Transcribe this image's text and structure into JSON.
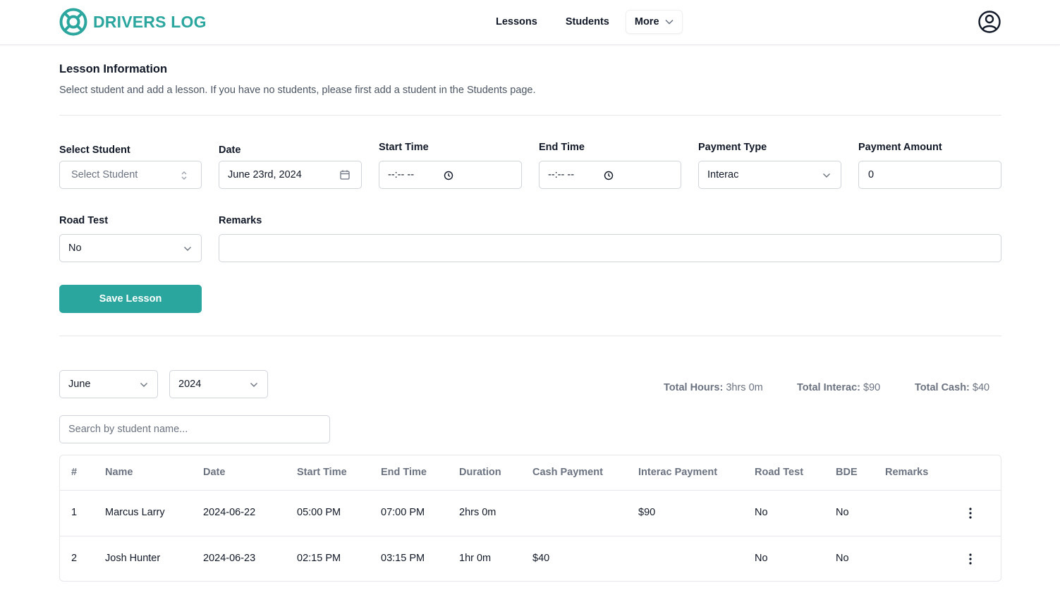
{
  "header": {
    "brand": "DRIVERS LOG",
    "nav": {
      "lessons": "Lessons",
      "students": "Students",
      "more": "More"
    }
  },
  "section": {
    "title": "Lesson Information",
    "description": "Select student and add a lesson. If you have no students, please first add a student in the Students page."
  },
  "form": {
    "student": {
      "label": "Select Student",
      "placeholder": "Select Student"
    },
    "date": {
      "label": "Date",
      "value": "June 23rd, 2024"
    },
    "start_time": {
      "label": "Start Time",
      "value": "--:-- --"
    },
    "end_time": {
      "label": "End Time",
      "value": "--:-- --"
    },
    "payment_type": {
      "label": "Payment Type",
      "value": "Interac"
    },
    "payment_amount": {
      "label": "Payment Amount",
      "value": "0"
    },
    "road_test": {
      "label": "Road Test",
      "value": "No"
    },
    "remarks": {
      "label": "Remarks",
      "value": ""
    },
    "save_label": "Save Lesson"
  },
  "filters": {
    "month": "June",
    "year": "2024",
    "search_placeholder": "Search by student name..."
  },
  "totals": {
    "hours_label": "Total Hours:",
    "hours_value": "3hrs 0m",
    "interac_label": "Total Interac:",
    "interac_value": "$90",
    "cash_label": "Total Cash:",
    "cash_value": "$40"
  },
  "table": {
    "columns": [
      "#",
      "Name",
      "Date",
      "Start Time",
      "End Time",
      "Duration",
      "Cash Payment",
      "Interac Payment",
      "Road Test",
      "BDE",
      "Remarks"
    ],
    "rows": [
      {
        "num": "1",
        "name": "Marcus Larry",
        "date": "2024-06-22",
        "start": "05:00 PM",
        "end": "07:00 PM",
        "duration": "2hrs 0m",
        "cash": "",
        "interac": "$90",
        "road_test": "No",
        "bde": "No",
        "remarks": ""
      },
      {
        "num": "2",
        "name": "Josh Hunter",
        "date": "2024-06-23",
        "start": "02:15 PM",
        "end": "03:15 PM",
        "duration": "1hr 0m",
        "cash": "$40",
        "interac": "",
        "road_test": "No",
        "bde": "No",
        "remarks": ""
      }
    ]
  },
  "colors": {
    "brand": "#2aa69e",
    "text": "#111827",
    "muted": "#6b7280",
    "border": "#e5e7eb"
  }
}
